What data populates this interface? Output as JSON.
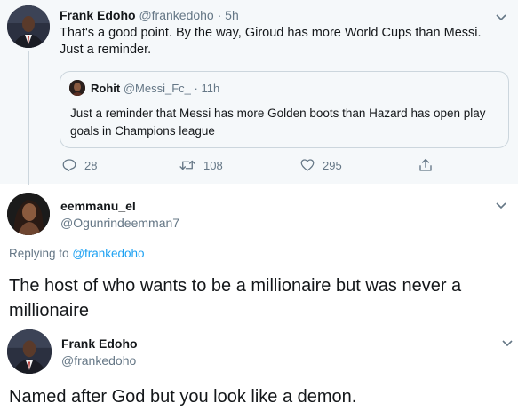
{
  "parent_tweet": {
    "author_name": "Frank Edoho",
    "author_handle": "@frankedoho",
    "time": "· 5h",
    "text": "That's a good point. By the way, Giroud has more World Cups than Messi. Just a reminder.",
    "quote": {
      "author_name": "Rohit",
      "author_handle": "@Messi_Fc_",
      "time": "· 11h",
      "text": "Just a reminder that Messi has more Golden boots than Hazard has open play goals in Champions league"
    },
    "actions": {
      "reply_count": "28",
      "retweet_count": "108",
      "like_count": "295"
    }
  },
  "reply_tweet": {
    "author_name": "eemmanu_el",
    "author_handle": "@Ogunrindeemman7",
    "replying_prefix": "Replying to",
    "replying_to": "@frankedoho",
    "text": "The host of who wants to be a millionaire but was never a millionaire"
  },
  "final_tweet": {
    "author_name": "Frank Edoho",
    "author_handle": "@frankedoho",
    "text": "Named after God but you look like a demon."
  },
  "colors": {
    "parent_background": "#f5f8fa",
    "link": "#1da1f2",
    "muted": "#657786",
    "text": "#14171a"
  },
  "icons": [
    "reply-icon",
    "retweet-icon",
    "like-icon",
    "share-icon",
    "chevron-down-icon"
  ]
}
